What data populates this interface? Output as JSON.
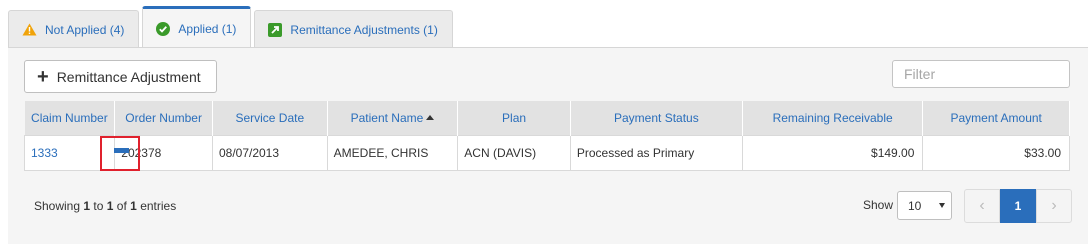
{
  "tabs": [
    {
      "label": "Not Applied (4)",
      "icon": "warning-icon",
      "color": "#f0a30a"
    },
    {
      "label": "Applied (1)",
      "icon": "check-circle-icon",
      "color": "#3a9a2a",
      "active": true
    },
    {
      "label": "Remittance Adjustments (1)",
      "icon": "arrow-up-right-icon",
      "color": "#3a9a2a"
    }
  ],
  "toolbar": {
    "add_icon": "+",
    "add_label": "Remittance Adjustment",
    "filter_placeholder": "Filter"
  },
  "table": {
    "columns": [
      "Claim Number",
      "Order Number",
      "Service Date",
      "Patient Name",
      "Plan",
      "Payment Status",
      "Remaining Receivable",
      "Payment Amount"
    ],
    "sorted_column": "Patient Name",
    "sort_direction": "ascending",
    "rows": [
      {
        "claim_number": "1333",
        "order_number": "202378",
        "service_date": "08/07/2013",
        "patient_name": "AMEDEE, CHRIS",
        "plan": "ACN (DAVIS)",
        "payment_status": "Processed as Primary",
        "remaining_receivable": "$149.00",
        "payment_amount": "$33.00"
      }
    ]
  },
  "footer": {
    "info_prefix": "Showing",
    "info_from": "1",
    "info_to_word": "to",
    "info_to": "1",
    "info_of_word": "of",
    "info_total": "1",
    "info_suffix": "entries",
    "show_label": "Show",
    "page_size": "10",
    "prev": "‹",
    "current_page": "1",
    "next": "›"
  },
  "colors": {
    "accent": "#2a6ebb",
    "highlight_box": "#e0212d"
  }
}
